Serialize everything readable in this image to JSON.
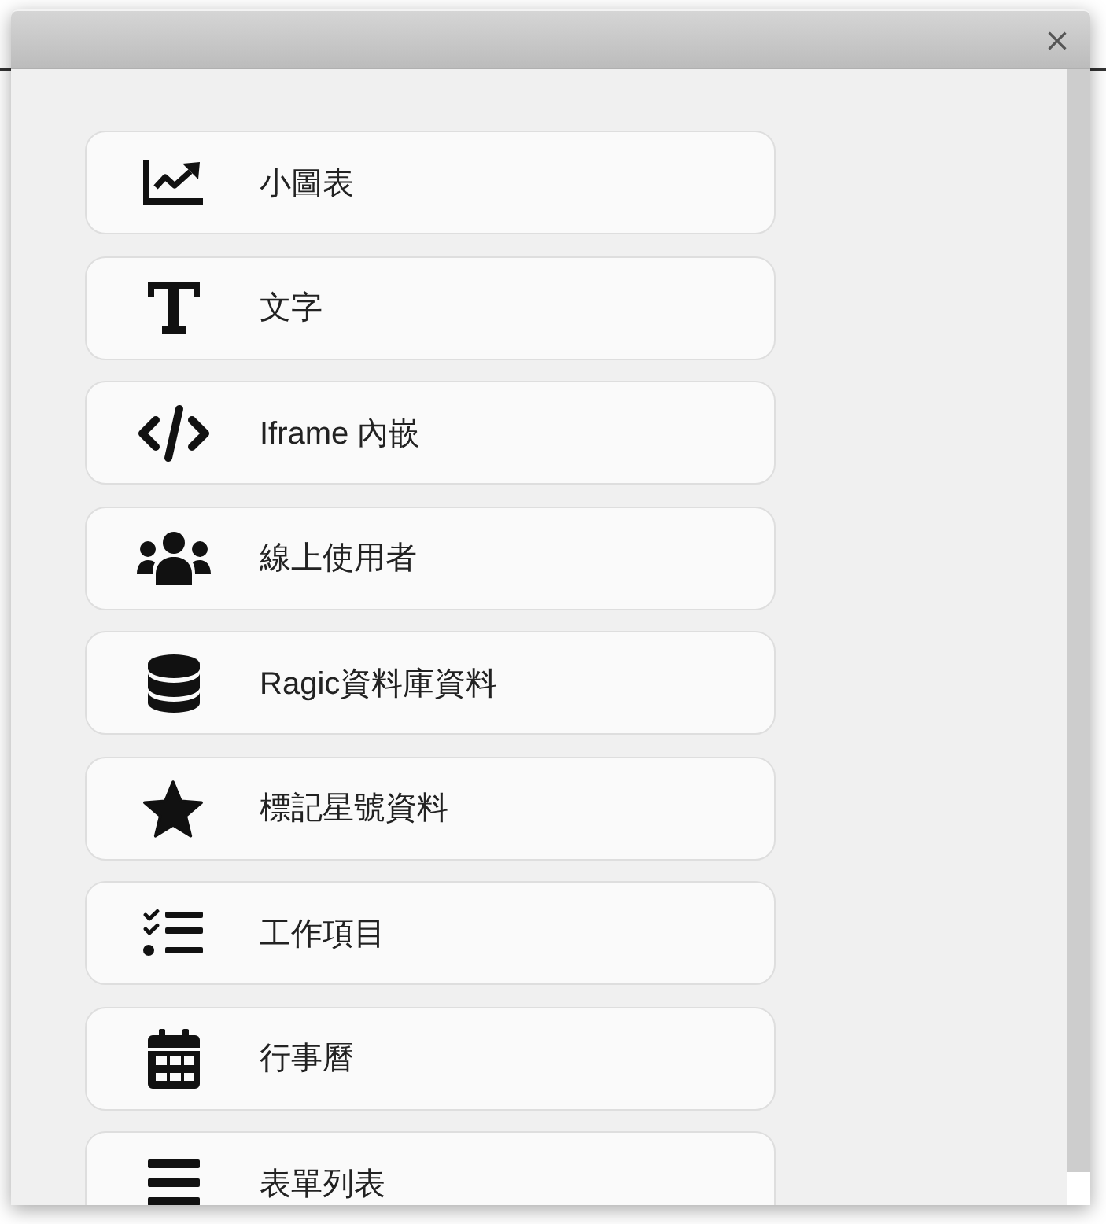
{
  "widgets": [
    {
      "kind": "chart",
      "label": "小圖表"
    },
    {
      "kind": "text",
      "label": "文字"
    },
    {
      "kind": "embed",
      "label": "Iframe 內嵌"
    },
    {
      "kind": "users",
      "label": "線上使用者"
    },
    {
      "kind": "database",
      "label": "Ragic資料庫資料"
    },
    {
      "kind": "star",
      "label": "標記星號資料"
    },
    {
      "kind": "tasks",
      "label": "工作項目"
    },
    {
      "kind": "calendar",
      "label": "行事曆"
    },
    {
      "kind": "list",
      "label": "表單列表"
    }
  ]
}
